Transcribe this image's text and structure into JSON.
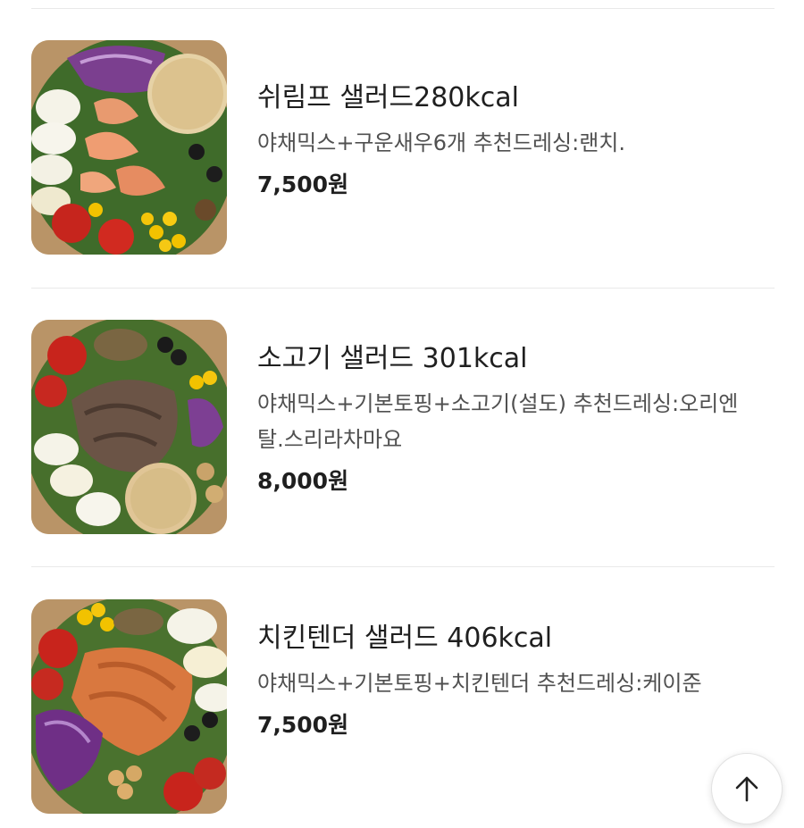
{
  "menu": {
    "items": [
      {
        "name": "쉬림프 샐러드280kcal",
        "description": "야채믹스+구운새우6개 추천드레싱:랜치.",
        "price": "7,500원",
        "image_icon": "shrimp-salad-photo"
      },
      {
        "name": "소고기 샐러드 301kcal",
        "description": "야채믹스+기본토핑+소고기(설도) 추천드레싱:오리엔탈.스리라차마요",
        "price": "8,000원",
        "image_icon": "beef-salad-photo"
      },
      {
        "name": "치킨텐더 샐러드 406kcal",
        "description": "야채믹스+기본토핑+치킨텐더 추천드레싱:케이준",
        "price": "7,500원",
        "image_icon": "chicken-tender-salad-photo"
      }
    ]
  },
  "scroll_top": {
    "icon": "arrow-up-icon"
  },
  "colors": {
    "divider": "#e9e9e9",
    "price": "#1f1f1f",
    "description": "#505050"
  }
}
